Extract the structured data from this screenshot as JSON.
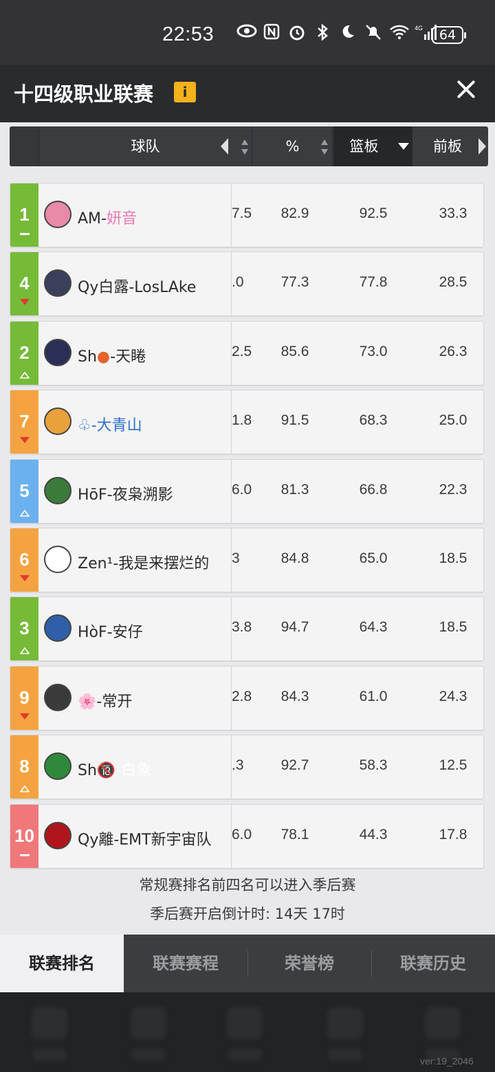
{
  "status_bar": {
    "time": "22:53",
    "battery": "64",
    "icons": [
      "eye-icon",
      "nfc-icon",
      "alarm-icon",
      "bluetooth-icon",
      "moon-icon",
      "mute-icon",
      "wifi-icon",
      "signal-4g-icon"
    ]
  },
  "header": {
    "title": "十四级职业联赛",
    "info_label": "i"
  },
  "table": {
    "columns": {
      "team": "球队",
      "pct": "%",
      "reb": "篮板",
      "oreb": "前板"
    },
    "rows": [
      {
        "rank": "1",
        "trend": "same",
        "color": "#76bb38",
        "team_prefix": "AM-",
        "team_suffix": "妍音",
        "suffix_color": "#f07ab0",
        "s0": "7.5",
        "s1": "82.9",
        "s2": "92.5",
        "s3": "33.3",
        "logo_color": "#e88aa8"
      },
      {
        "rank": "4",
        "trend": "down",
        "color": "#76bb38",
        "team_prefix": "Qy白露-LosLAke",
        "team_suffix": "",
        "suffix_color": "#2b2b2b",
        "s0": ".0",
        "s1": "77.3",
        "s2": "77.8",
        "s3": "28.5",
        "logo_color": "#3a3f5c"
      },
      {
        "rank": "2",
        "trend": "up",
        "color": "#76bb38",
        "team_prefix": "Sh",
        "team_emoji": "●",
        "team_suffix": "-天睠",
        "suffix_color": "#2b2b2b",
        "s0": "2.5",
        "s1": "85.6",
        "s2": "73.0",
        "s3": "26.3",
        "logo_color": "#2b2f55"
      },
      {
        "rank": "7",
        "trend": "down",
        "color": "#f5a341",
        "team_prefix": "♧-大青山",
        "team_suffix": "",
        "suffix_color": "#2b2b2b",
        "prefix_color": "#2d6fc8",
        "s0": "1.8",
        "s1": "91.5",
        "s2": "68.3",
        "s3": "25.0",
        "logo_color": "#e9a23b"
      },
      {
        "rank": "5",
        "trend": "up",
        "color": "#6cb1ef",
        "team_prefix": "HōF-夜枭溯影",
        "team_suffix": "",
        "suffix_color": "#2b2b2b",
        "s0": "6.0",
        "s1": "81.3",
        "s2": "66.8",
        "s3": "22.3",
        "logo_color": "#3a7a3a"
      },
      {
        "rank": "6",
        "trend": "down",
        "color": "#f5a341",
        "team_prefix": "Zen¹-我是来摆烂的",
        "team_suffix": "",
        "suffix_color": "#2b2b2b",
        "s0": "3",
        "s1": "84.8",
        "s2": "65.0",
        "s3": "18.5",
        "logo_color": "#ffffff"
      },
      {
        "rank": "3",
        "trend": "up",
        "color": "#76bb38",
        "team_prefix": "HòF-安仔",
        "team_suffix": "",
        "suffix_color": "#2b2b2b",
        "s0": "3.8",
        "s1": "94.7",
        "s2": "64.3",
        "s3": "18.5",
        "logo_color": "#2f5fa8"
      },
      {
        "rank": "9",
        "trend": "down",
        "color": "#f5a341",
        "team_prefix": "🌸-常开",
        "team_suffix": "",
        "suffix_color": "#2b2b2b",
        "s0": "2.8",
        "s1": "84.3",
        "s2": "61.0",
        "s3": "24.3",
        "logo_color": "#3a3a3a"
      },
      {
        "rank": "8",
        "trend": "up",
        "color": "#f5a341",
        "team_prefix": "Sh",
        "team_emoji": "🔞",
        "team_suffix": "-白象",
        "suffix_color": "#ffffff",
        "s0": ".3",
        "s1": "92.7",
        "s2": "58.3",
        "s3": "12.5",
        "logo_color": "#2e8a3a"
      },
      {
        "rank": "10",
        "trend": "same",
        "color": "#f0787a",
        "team_prefix": "Qy離-EMT新宇宙队",
        "team_suffix": "",
        "suffix_color": "#2b2b2b",
        "s0": "6.0",
        "s1": "78.1",
        "s2": "44.3",
        "s3": "17.8",
        "logo_color": "#b0141c"
      }
    ]
  },
  "notes": {
    "line1": "常规赛排名前四名可以进入季后赛",
    "line2": "季后赛开启倒计时: 14天 17时"
  },
  "tabs": [
    "联赛排名",
    "联赛赛程",
    "荣誉榜",
    "联赛历史"
  ],
  "version": "ver:19_2046"
}
